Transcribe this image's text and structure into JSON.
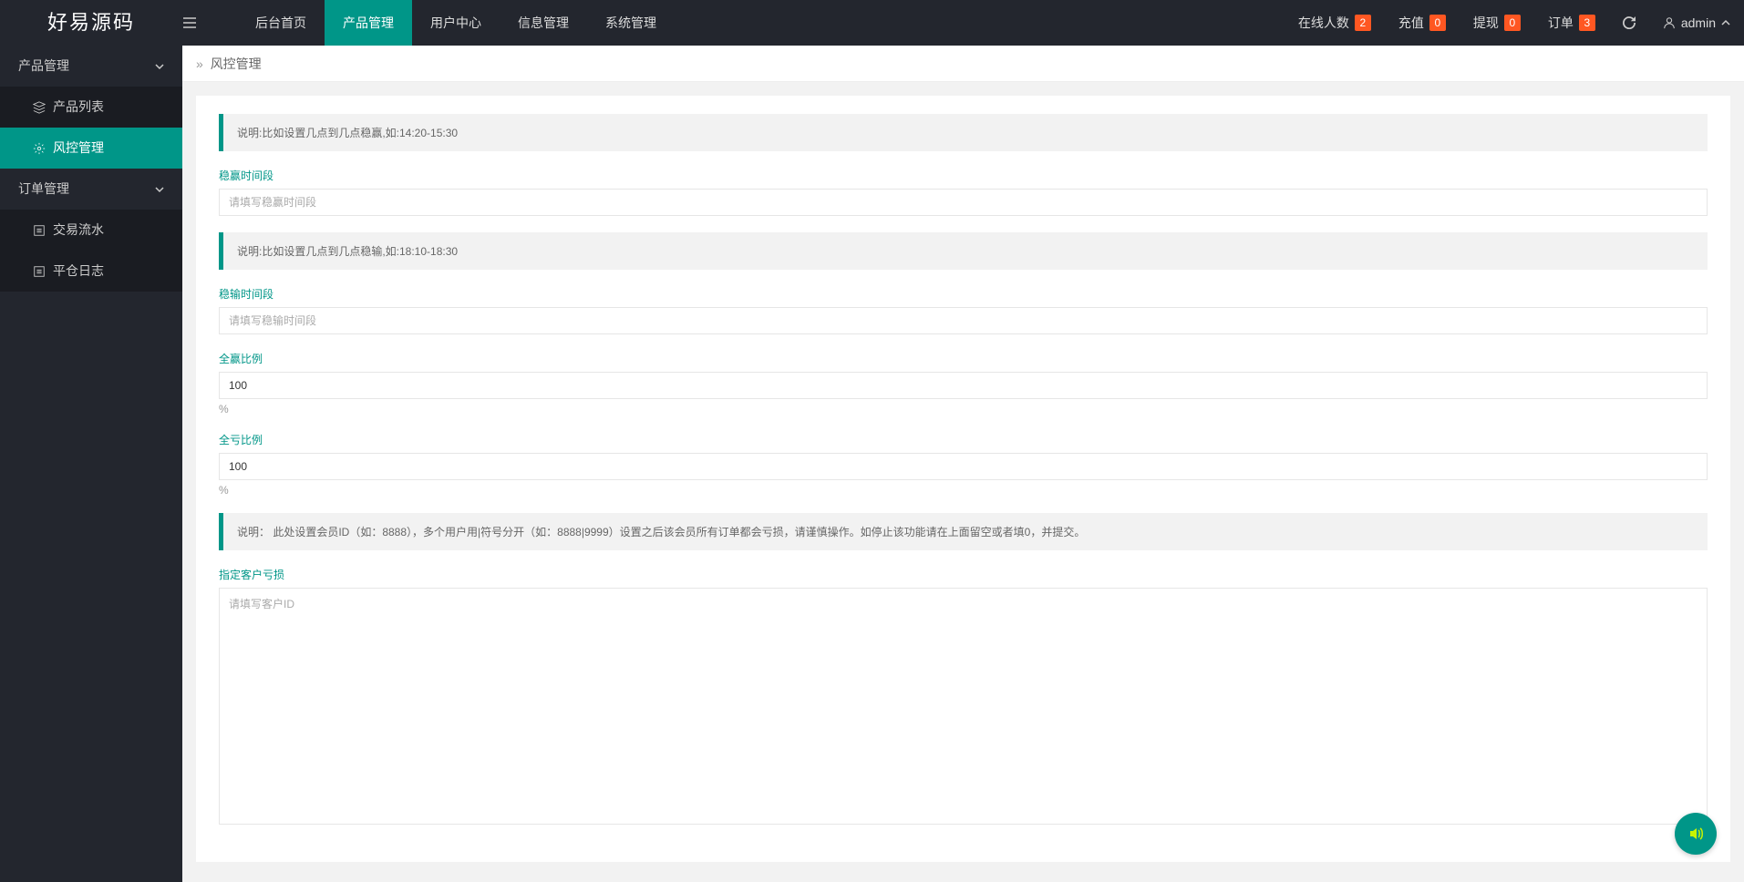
{
  "logo": "好易源码",
  "topNav": {
    "home": "后台首页",
    "product": "产品管理",
    "user": "用户中心",
    "info": "信息管理",
    "system": "系统管理"
  },
  "headerRight": {
    "online": {
      "label": "在线人数",
      "count": "2"
    },
    "recharge": {
      "label": "充值",
      "count": "0"
    },
    "withdraw": {
      "label": "提现",
      "count": "0"
    },
    "order": {
      "label": "订单",
      "count": "3"
    },
    "username": "admin"
  },
  "sidebar": {
    "productMgmt": "产品管理",
    "productList": "产品列表",
    "riskMgmt": "风控管理",
    "orderMgmt": "订单管理",
    "tradeFlow": "交易流水",
    "closeLog": "平仓日志"
  },
  "breadcrumb": {
    "title": "风控管理"
  },
  "form": {
    "note1": "说明:比如设置几点到几点稳赢,如:14:20-15:30",
    "winPeriod": {
      "label": "稳赢时间段",
      "placeholder": "请填写稳赢时间段",
      "value": ""
    },
    "note2": "说明:比如设置几点到几点稳输,如:18:10-18:30",
    "losePeriod": {
      "label": "稳输时间段",
      "placeholder": "请填写稳输时间段",
      "value": ""
    },
    "winRatio": {
      "label": "全赢比例",
      "value": "100",
      "hint": "%"
    },
    "loseRatio": {
      "label": "全亏比例",
      "value": "100",
      "hint": "%"
    },
    "note3": "说明： 此处设置会员ID（如：8888），多个用户用|符号分开（如：8888|9999）设置之后该会员所有订单都会亏损，请谨慎操作。如停止该功能请在上面留空或者填0，并提交。",
    "customerLoss": {
      "label": "指定客户亏损",
      "placeholder": "请填写客户ID",
      "value": ""
    }
  }
}
